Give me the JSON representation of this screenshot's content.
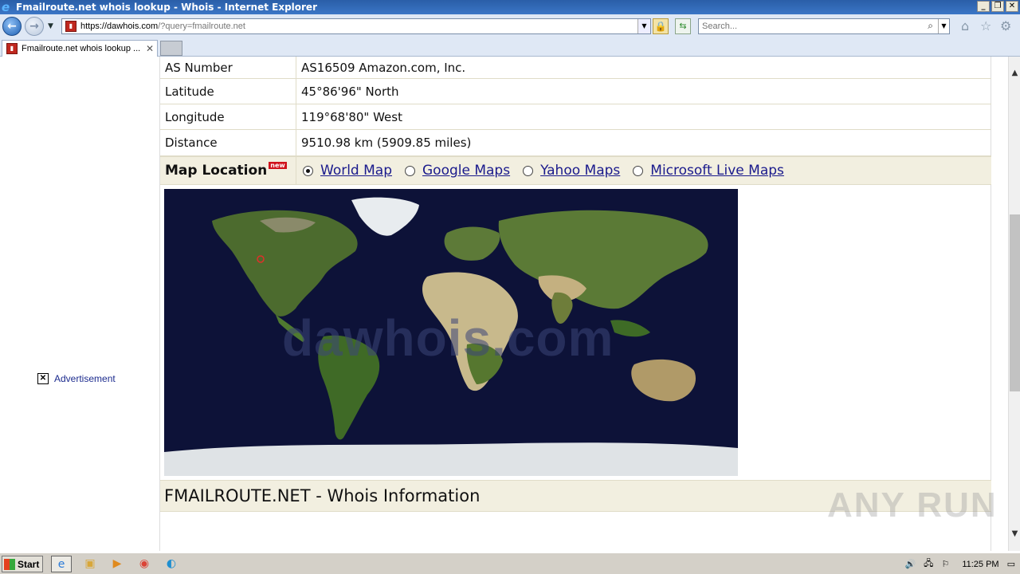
{
  "window": {
    "title": "Fmailroute.net whois lookup - Whois - Internet Explorer"
  },
  "nav": {
    "url_host": "https://dawhois.com",
    "url_rest": "/?query=fmailroute.net",
    "search_placeholder": "Search..."
  },
  "tabs": [
    {
      "label": "Fmailroute.net whois lookup ..."
    }
  ],
  "sidebar": {
    "ad_label": "Advertisement"
  },
  "details": [
    {
      "key": "AS Number",
      "value": "AS16509 Amazon.com, Inc."
    },
    {
      "key": "Latitude",
      "value": "45°86'96\" North"
    },
    {
      "key": "Longitude",
      "value": "119°68'80\" West"
    },
    {
      "key": "Distance",
      "value": "9510.98 km (5909.85 miles)"
    }
  ],
  "map_location": {
    "label": "Map Location",
    "badge": "new",
    "options": [
      {
        "label": "World Map",
        "selected": true
      },
      {
        "label": "Google Maps",
        "selected": false
      },
      {
        "label": "Yahoo Maps",
        "selected": false
      },
      {
        "label": "Microsoft Live Maps",
        "selected": false
      }
    ],
    "watermark": "dawhois.com"
  },
  "whois_heading": "FMAILROUTE.NET - Whois Information",
  "overlay": {
    "brand": "ANY RUN"
  },
  "taskbar": {
    "start_label": "Start",
    "clock": "11:25 PM"
  },
  "colors": {
    "map_ocean": "#0d1238",
    "link": "#1a1a8c",
    "section_bg": "#f2efe0"
  }
}
